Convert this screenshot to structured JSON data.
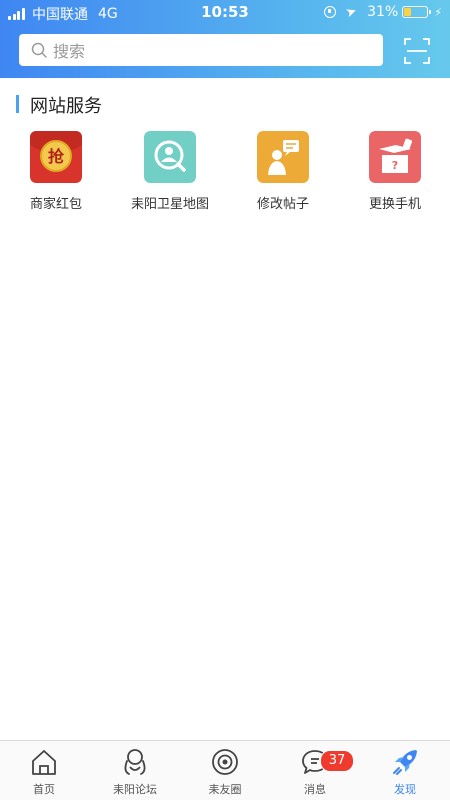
{
  "status_bar": {
    "carrier": "中国联通",
    "network": "4G",
    "time": "10:53",
    "battery_percent": "31%",
    "battery_level": 0.31
  },
  "search": {
    "placeholder": "搜索"
  },
  "section": {
    "title": "网站服务"
  },
  "services": [
    {
      "label": "商家红包",
      "icon": "red-packet-icon",
      "color": "#d8342b",
      "glyph": "抢"
    },
    {
      "label": "耒阳卫星地图",
      "icon": "map-search-icon",
      "color": "#72cfc5"
    },
    {
      "label": "修改帖子",
      "icon": "edit-post-icon",
      "color": "#eeaa36"
    },
    {
      "label": "更换手机",
      "icon": "change-phone-icon",
      "color": "#ea6566"
    }
  ],
  "tabbar": {
    "tabs": [
      {
        "label": "首页",
        "icon": "home-icon"
      },
      {
        "label": "耒阳论坛",
        "icon": "forum-icon"
      },
      {
        "label": "耒友圈",
        "icon": "friends-circle-icon"
      },
      {
        "label": "消息",
        "icon": "message-icon",
        "badge": "37"
      },
      {
        "label": "发现",
        "icon": "discover-icon",
        "active": true
      }
    ]
  },
  "colors": {
    "accent": "#3f86f2",
    "badge": "#ee3b2e"
  }
}
